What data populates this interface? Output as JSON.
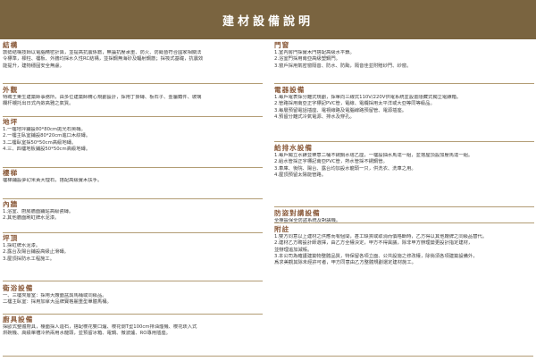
{
  "title": "建材設備說明",
  "left": [
    {
      "title": "結構",
      "lines": [
        "敦勢結構技師以電腦精密計算，並提高抗震係數，無論抗壓承重、防火、防颱皆符合國家相關法",
        "令標準，樑柱、樓板、外牆均採水久性RC結構，並採鋼無海砂及輻射鋼筋；採筏式基礎，抗震效",
        "能提升，建物穩固安全無慮。"
      ]
    },
    {
      "title": "外觀",
      "lines": [
        "特聘王東生建築師事務所，由多位建築師精心規劃設計，採用丁掛磚、板石子、金屬鐵件、玻璃",
        "欄杆襯托出日式內斂高雅之氣質。"
      ]
    },
    {
      "title": "地坪",
      "lines": [
        "1.一樓地坪鋪設80*80cm拋光石英磚。",
        "2.一樓主臥室鋪設80*20cm進口木紋磚。",
        "3.二樓臥室採50*50cm高級地磚。",
        "4.三、四樓地板鋪設50*50cm高級地磚。"
      ]
    },
    {
      "title": "樓梯",
      "lines": [
        "樓梯鋪設夢幻米黃大理石，搭配高級實木扶手。"
      ]
    },
    {
      "title": "內牆",
      "lines": [
        "1.浴室、廚房牆面鋪貼高級瓷磚。",
        "2.其他牆面刷虹牌水泥漆。"
      ]
    },
    {
      "title": "坪頂",
      "lines": [
        "1.採虹牌水泥漆。",
        "2.露台及陽台鋪設高級止滑磚。",
        "3.屋頂採防水工程施工。"
      ]
    },
    {
      "title": "衛浴設備",
      "lines": [
        "一、三樓夾層室：採用大廠面盆與馬桶或同級品。",
        "二樓主臥室：採用加拿大品牌寶格麗重型單體馬桶。"
      ]
    },
    {
      "title": "廚具設備",
      "lines": [
        "採歐式整體廚具，檯面採人造石，搭配櫻花雙口爐、櫻花側T型100cm排油煙機、櫻花崁入式",
        "烘碗機、高級單槽冷熱兩用水龍頭，並預留冰箱、電鍋、微波爐、RO專用插座。"
      ]
    }
  ],
  "right": [
    {
      "title": "門窗",
      "lines": [
        "1.室內房門採實木門搭配高級水平鎖。",
        "2.浴室門採用南亞高級塑鋼門。",
        "3.窗戶採用氣密窗隔音、防水、防颱，隔音佳並附贈紗門、紗窗。"
      ]
    },
    {
      "title": "電器設備",
      "lines": [
        "1.每戶電表採分離式規劃，採單向三線式110V/220V供電系統並設置隱藏式獨立電錶箱。",
        "2.管路採用南亞正字標記PVC管，電線、電纜採用太平洋或大亞等同等級品。",
        "3.每層預留電話插座、電視線路及電腦線路預留管、電源插座。",
        "4.預留分離式冷氣電源、排水及穿孔。"
      ]
    },
    {
      "title": "給排水設備",
      "lines": [
        "1.每戶獨立水錶並樂意二桶不銹鋼水塔乙座，一樓設抽水馬達一組，並搭屋頂設加壓馬達一組。",
        "2.給水管採正字標記南亞PVC管，熱水管採不銹鋼管。",
        "3.車庫、後院、陽台、露台均加設水龍頭一只，供洗衣、洗車之用。",
        "4.屋頂預留太陽能管路。"
      ]
    },
    {
      "title": "防盜對講設備",
      "lines": [
        "全棟設保全防盜系統及對講機。"
      ]
    },
    {
      "title": "附註",
      "lines": [
        "1.雙方同意以上建材之供應而有個間，甚工缺貨或取消而價格斷時，乙方得以其他廠牌之同級品替代。",
        "2.建材乙方聘設計師選擇，由乙方全權決定，甲方不得異議，除非甲方辦理變更設計指定建材，",
        "   並辦理追加減帳。",
        "3.本公司為確護建築物整體品質，特保留各項立面、公共設施之修改權，除倘須各項建築設備外，",
        "   爲求美觀其除未經許可者，甲方同意由乙方整體規劃選定建材施工。"
      ]
    }
  ]
}
